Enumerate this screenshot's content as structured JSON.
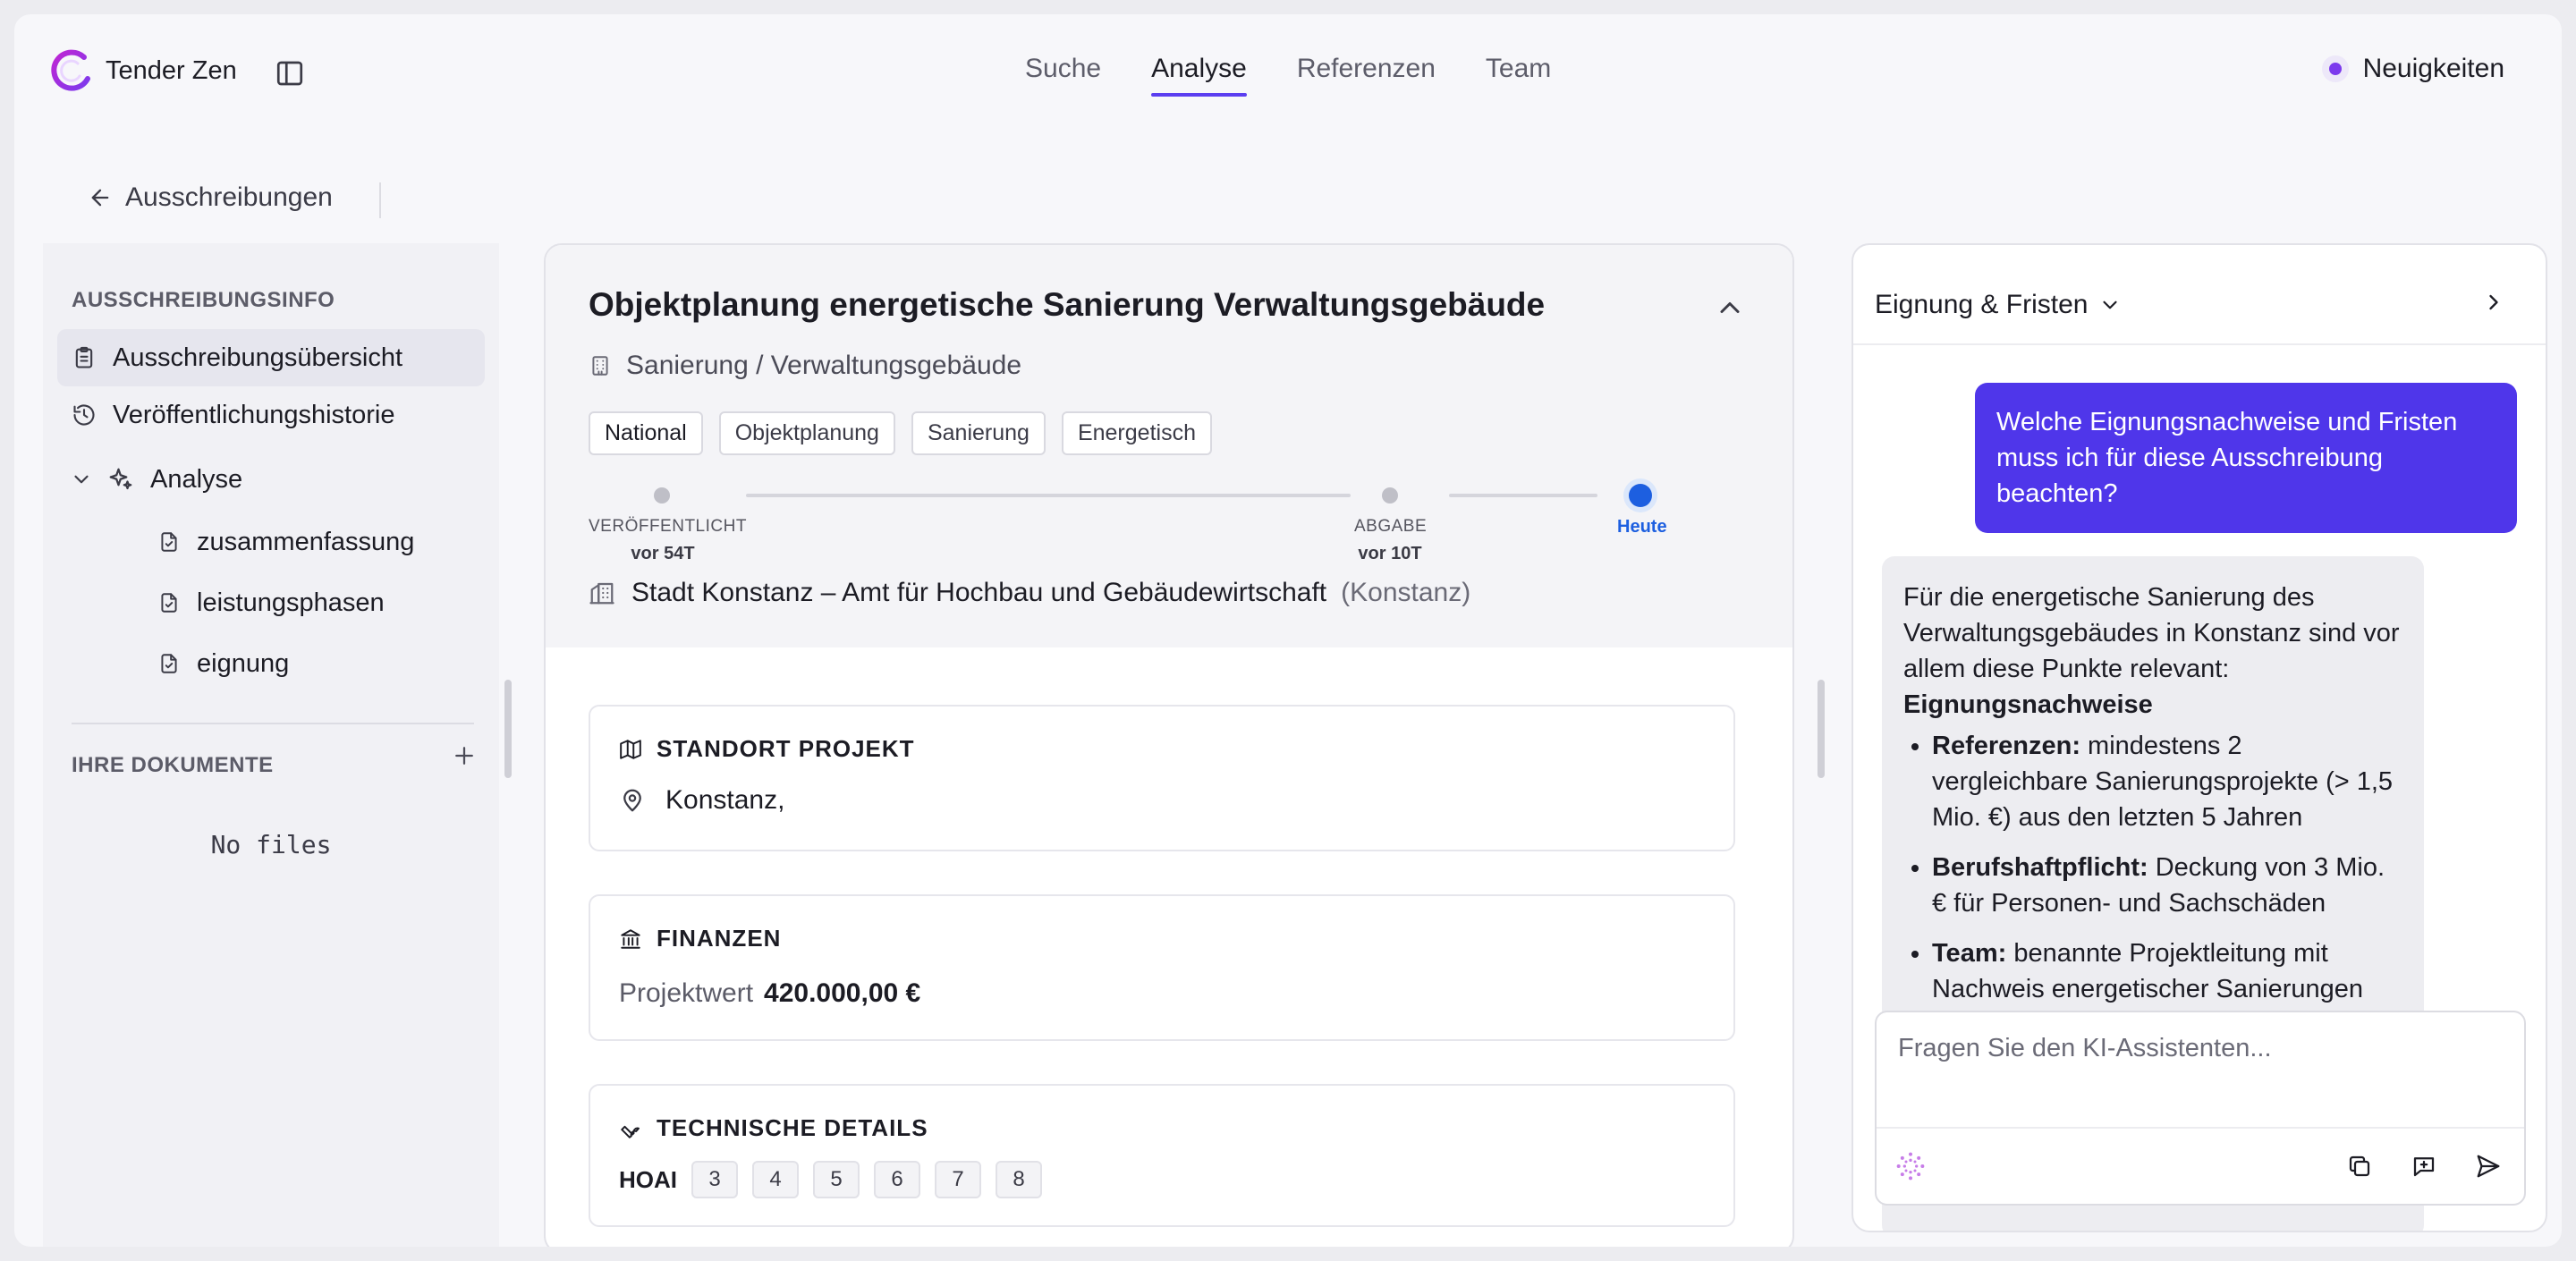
{
  "app": {
    "name": "Tender Zen"
  },
  "nav": {
    "tabs": [
      {
        "label": "Suche"
      },
      {
        "label": "Analyse"
      },
      {
        "label": "Referenzen"
      },
      {
        "label": "Team"
      }
    ],
    "active_tab": "Analyse",
    "news_label": "Neuigkeiten"
  },
  "back": {
    "label": "Ausschreibungen"
  },
  "sidebar": {
    "info_title": "Ausschreibungsinfo",
    "items": [
      {
        "label": "Ausschreibungsübersicht",
        "icon": "clipboard-icon"
      },
      {
        "label": "Veröffentlichungshistorie",
        "icon": "history-icon"
      },
      {
        "label": "Analyse",
        "icon": "sparkles-icon"
      }
    ],
    "sub_items": [
      {
        "label": "zusammenfassung",
        "icon": "file-check-icon"
      },
      {
        "label": "leistungsphasen",
        "icon": "file-check-icon"
      },
      {
        "label": "eignung",
        "icon": "file-check-icon"
      }
    ],
    "docs_title": "Ihre Dokumente",
    "no_files": "No files"
  },
  "tender": {
    "title": "Objektplanung energetische Sanierung Verwaltungsgebäude",
    "category": "Sanierung / Verwaltungsgebäude",
    "tags": [
      "National",
      "Objektplanung",
      "Sanierung",
      "Energetisch"
    ],
    "timeline": {
      "published_label": "Veröffentlicht",
      "published_ago": "vor 54T",
      "deadline_label": "Abgabe",
      "deadline_ago": "vor 10T",
      "today_label": "Heute"
    },
    "authority": "Stadt Konstanz – Amt für Hochbau und Gebäudewirtschaft",
    "authority_city": "(Konstanz)",
    "location_title": "Standort Projekt",
    "location_value": "Konstanz,",
    "finance_title": "Finanzen",
    "finance_label": "Projektwert",
    "finance_value": "420.000,00 €",
    "tech_title": "Technische Details",
    "hoai_label": "HOAI",
    "hoai_phases": [
      "3",
      "4",
      "5",
      "6",
      "7",
      "8"
    ]
  },
  "chat": {
    "title": "Eignung & Fristen",
    "user_message": "Welche Eignungsnachweise und Fristen muss ich für diese Ausschreibung beachten?",
    "bot_intro": "Für die energetische Sanierung des Verwaltungsgebäudes in Konstanz sind vor allem diese Punkte relevant:",
    "bot_heading": "Eignungsnachweise",
    "bot_points": [
      {
        "term": "Referenzen:",
        "text": " mindestens 2 vergleichbare Sanierungsprojekte (> 1,5 Mio. €) aus den letzten 5 Jahren"
      },
      {
        "term": "Berufshaftpflicht:",
        "text": " Deckung von 3 Mio. € für Personen- und Sachschäden"
      },
      {
        "term": "Team:",
        "text": " benannte Projektleitung mit Nachweis energetischer Sanierungen"
      }
    ],
    "input_placeholder": "Fragen Sie den KI-Assistenten..."
  },
  "colors": {
    "accent": "#4f36ea",
    "today": "#1d5fe0",
    "news_dot": "#7c3aed"
  }
}
